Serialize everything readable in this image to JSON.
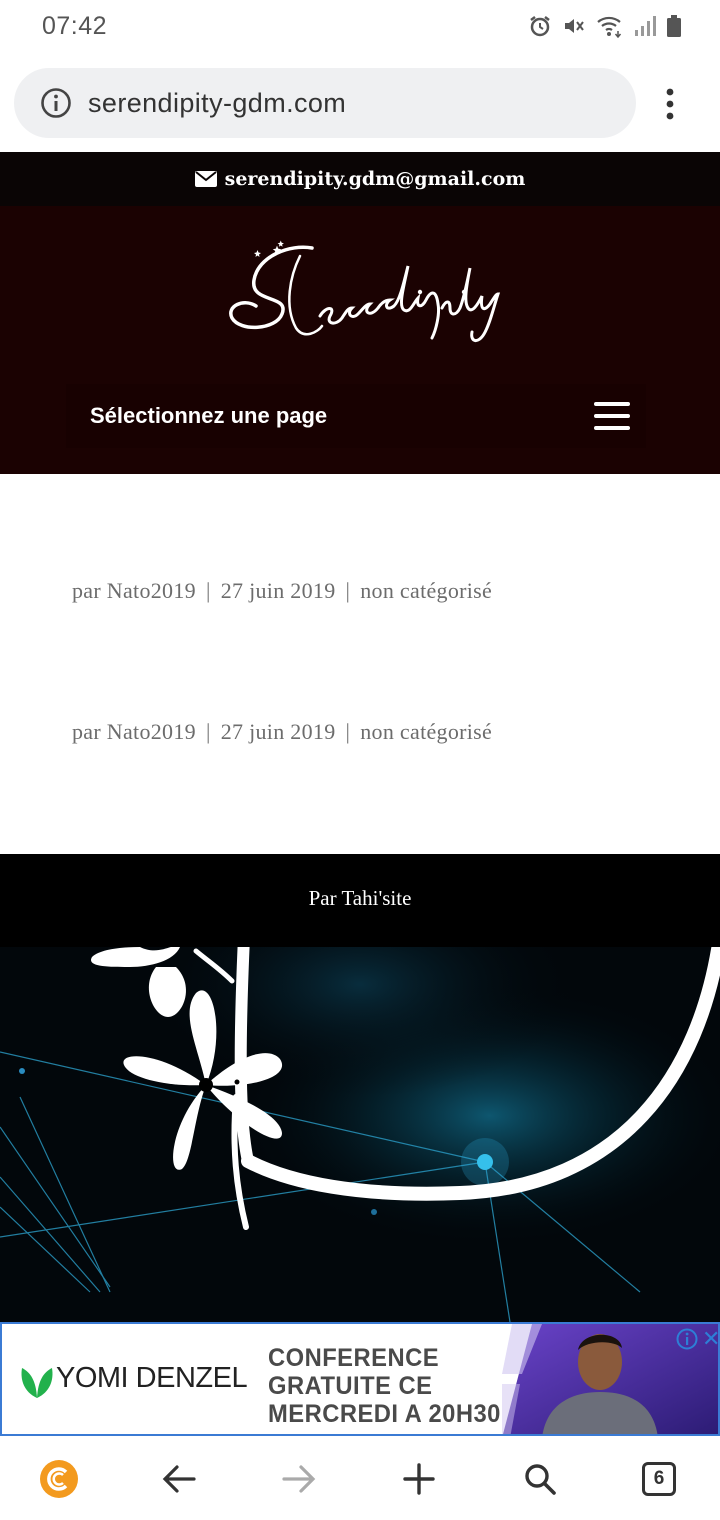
{
  "status_bar": {
    "time": "07:42",
    "icons": [
      "alarm-icon",
      "mute-icon",
      "wifi-icon",
      "signal-icon",
      "battery-icon"
    ]
  },
  "browser": {
    "url": "serendipity-gdm.com",
    "tab_count": "6"
  },
  "site": {
    "email": "serendipity.gdm@gmail.com",
    "logo_text": "Serendipity",
    "nav_label": "Sélectionnez une page",
    "posts": [
      {
        "author": "par Nato2019",
        "date": "27 juin 2019",
        "category": "non catégorisé"
      },
      {
        "author": "par Nato2019",
        "date": "27 juin 2019",
        "category": "non catégorisé"
      }
    ],
    "footer_credit": "Par Tahi'site"
  },
  "ad": {
    "brand": "YOMI DENZEL",
    "lines": [
      "CONFERENCE",
      "GRATUITE CE",
      "MERCREDI A 20H30"
    ]
  },
  "colors": {
    "header_bg": "#1b0202",
    "email_bar_bg": "#0a0505",
    "ad_border": "#3b7bd4",
    "brand_orange": "#f39a1e"
  }
}
